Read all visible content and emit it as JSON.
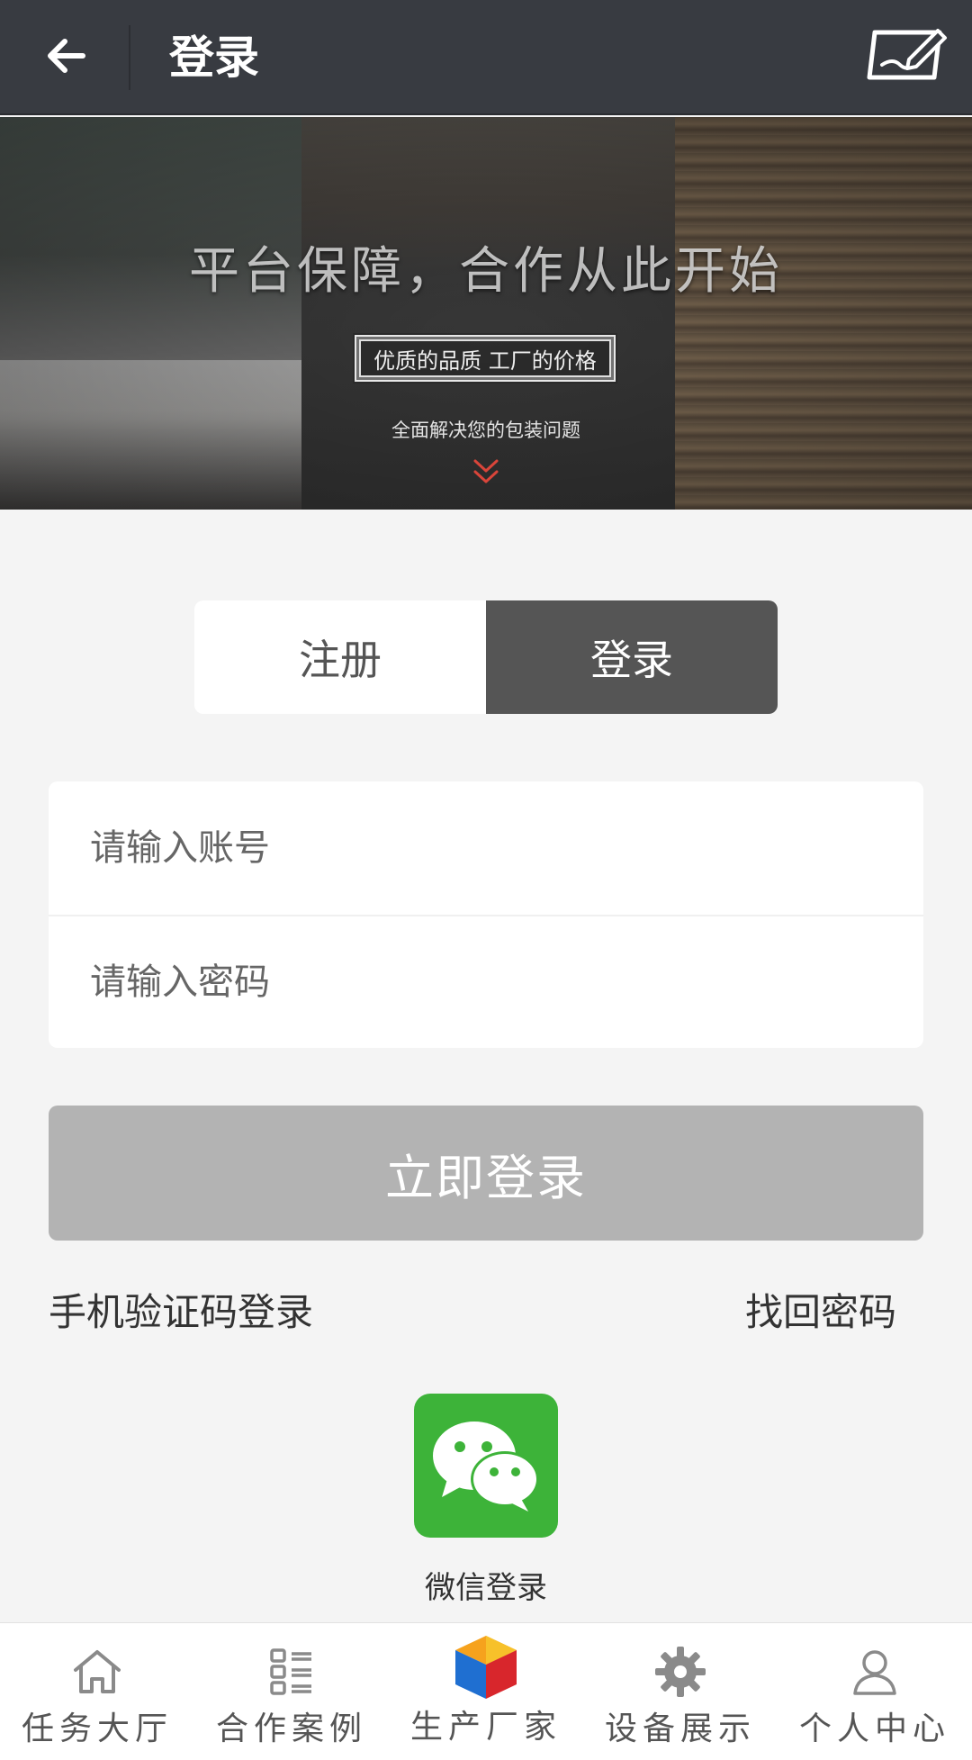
{
  "header": {
    "title": "登录"
  },
  "banner": {
    "headline": "平台保障，合作从此开始",
    "tag": "优质的品质 工厂的价格",
    "subtitle": "全面解决您的包装问题"
  },
  "tabs": [
    {
      "label": "注册",
      "active": false
    },
    {
      "label": "登录",
      "active": true
    }
  ],
  "form": {
    "account_placeholder": "请输入账号",
    "password_placeholder": "请输入密码",
    "submit_label": "立即登录"
  },
  "links": {
    "sms_login": "手机验证码登录",
    "forgot_password": "找回密码"
  },
  "wechat": {
    "label": "微信登录"
  },
  "bottom_nav": [
    {
      "label": "任务大厅",
      "icon": "home-icon"
    },
    {
      "label": "合作案例",
      "icon": "list-icon"
    },
    {
      "label": "生产厂家",
      "icon": "cube-icon"
    },
    {
      "label": "设备展示",
      "icon": "gear-icon"
    },
    {
      "label": "个人中心",
      "icon": "user-icon"
    }
  ],
  "colors": {
    "header_bg": "#383b41",
    "tab_active": "#555555",
    "submit_disabled": "#b3b3b3",
    "wechat_green": "#3db339"
  }
}
